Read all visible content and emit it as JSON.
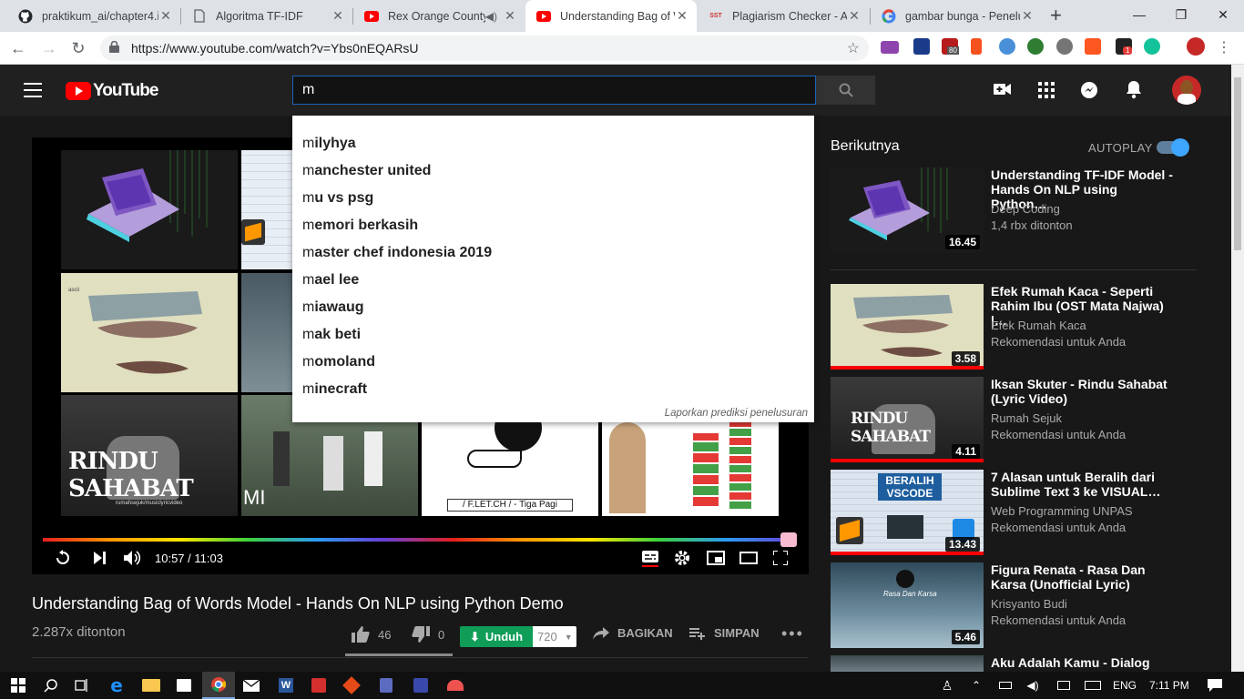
{
  "browser": {
    "tabs": [
      {
        "title": "praktikum_ai/chapter4.i",
        "icon": "github-icon"
      },
      {
        "title": "Algoritma TF-IDF",
        "icon": "document-icon"
      },
      {
        "title": "Rex Orange County",
        "icon": "youtube-icon",
        "audio": true
      },
      {
        "title": "Understanding Bag of W",
        "icon": "youtube-icon",
        "active": true
      },
      {
        "title": "Plagiarism Checker - A",
        "icon": "sst-icon"
      },
      {
        "title": "gambar bunga - Penelu",
        "icon": "google-icon"
      }
    ],
    "sst_label": "SST",
    "url": "https://www.youtube.com/watch?v=Ybs0nEQARsU",
    "ext_badges": {
      "first": "80",
      "second": "1"
    }
  },
  "youtube": {
    "logo": "YouTube",
    "search_value": "m",
    "suggestions": [
      {
        "typed": "m",
        "rest": "ilyhya"
      },
      {
        "typed": "m",
        "rest": "anchester united"
      },
      {
        "typed": "m",
        "rest": "u vs psg"
      },
      {
        "typed": "m",
        "rest": "emori berkasih"
      },
      {
        "typed": "m",
        "rest": "aster chef indonesia 2019"
      },
      {
        "typed": "m",
        "rest": "ael lee"
      },
      {
        "typed": "m",
        "rest": "iawaug"
      },
      {
        "typed": "m",
        "rest": "ak beti"
      },
      {
        "typed": "m",
        "rest": "omoland"
      },
      {
        "typed": "m",
        "rest": "inecraft"
      }
    ],
    "report_label": "Laporkan prediksi penelusuran",
    "player": {
      "time": "10:57 / 11:03",
      "progress": 0.991,
      "overlay_rindu": "RINDU SAHABAT",
      "overlay_rindu_credit": "rumahsejuk/musiclyricvideo",
      "overlay_mi": "MI",
      "overlay_fletch": "/ F.LET.CH / - Tiga Pagi",
      "overlay_ascii": "ascii"
    },
    "video": {
      "title": "Understanding Bag of Words Model - Hands On NLP using Python Demo",
      "views": "2.287x ditonton",
      "likes": "46",
      "dislikes": "0",
      "download": "Unduh",
      "quality": "720",
      "share": "BAGIKAN",
      "save": "SIMPAN"
    },
    "sidebar": {
      "heading": "Berikutnya",
      "autoplay": "AUTOPLAY",
      "cards": [
        {
          "title": "Understanding TF-IDF Model - Hands On NLP using Python…",
          "channel": "Deep Coding",
          "meta": "1,4 rbx ditonton",
          "duration": "16.45"
        },
        {
          "title": "Efek Rumah Kaca - Seperti Rahim Ibu (OST Mata Najwa) |…",
          "channel": "Efek Rumah Kaca",
          "meta": "Rekomendasi untuk Anda",
          "duration": "3.58"
        },
        {
          "title": "Iksan Skuter - Rindu Sahabat (Lyric Video)",
          "channel": "Rumah Sejuk",
          "meta": "Rekomendasi untuk Anda",
          "duration": "4.11"
        },
        {
          "title": "7 Alasan untuk Beralih dari Sublime Text 3 ke VISUAL…",
          "channel": "Web Programming UNPAS",
          "meta": "Rekomendasi untuk Anda",
          "duration": "13.43"
        },
        {
          "title": "Figura Renata - Rasa Dan Karsa (Unofficial Lyric)",
          "channel": "Krisyanto Budi",
          "meta": "Rekomendasi untuk Anda",
          "duration": "5.46"
        },
        {
          "title": "Aku Adalah Kamu - Dialog Dini",
          "channel": "",
          "meta": "",
          "duration": ""
        }
      ],
      "beralih": "BERALIH",
      "vscode": "VSCODE",
      "rasa_karsa": "Rasa Dan Karsa",
      "rindu_overlay": "RINDU SAHABAT"
    }
  },
  "taskbar": {
    "lang": "ENG",
    "time": "7:11 PM"
  },
  "colors": {
    "yt_red": "#ff0000",
    "yt_dark": "#181818",
    "header": "#202020",
    "download_green": "#0f9d58",
    "search_border": "#1c62b9"
  }
}
